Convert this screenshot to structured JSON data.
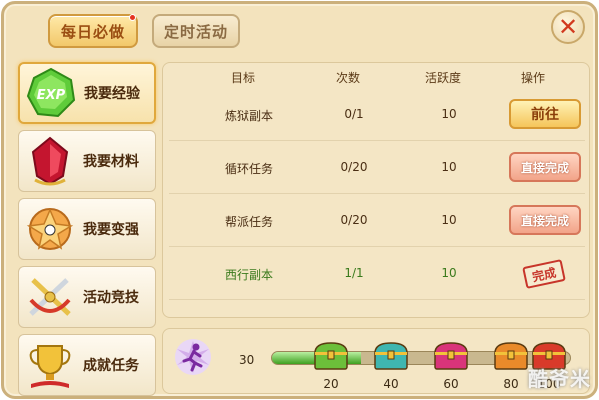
{
  "tabs": [
    {
      "label": "每日必做",
      "active": true,
      "has_notification": true
    },
    {
      "label": "定时活动",
      "active": false
    }
  ],
  "sidebar": {
    "items": [
      {
        "label": "我要经验",
        "icon": "exp-gem-icon",
        "active": true
      },
      {
        "label": "我要材料",
        "icon": "red-crystal-icon",
        "active": false
      },
      {
        "label": "我要变强",
        "icon": "ornament-icon",
        "active": false
      },
      {
        "label": "活动竞技",
        "icon": "crossed-swords-icon",
        "active": false
      },
      {
        "label": "成就任务",
        "icon": "trophy-cup-icon",
        "active": false
      }
    ]
  },
  "table": {
    "headers": [
      "目标",
      "次数",
      "活跃度",
      "操作"
    ],
    "rows": [
      {
        "target": "炼狱副本",
        "count": "0/1",
        "activity": "10",
        "action": "前往",
        "action_type": "go"
      },
      {
        "target": "循环任务",
        "count": "0/20",
        "activity": "10",
        "action": "直接完成",
        "action_type": "complete"
      },
      {
        "target": "帮派任务",
        "count": "0/20",
        "activity": "10",
        "action": "直接完成",
        "action_type": "complete"
      },
      {
        "target": "西行副本",
        "count": "1/1",
        "activity": "10",
        "action": "完成",
        "action_type": "done"
      }
    ]
  },
  "progress": {
    "current": "30",
    "max": 100,
    "milestones": [
      "20",
      "40",
      "60",
      "80",
      "100"
    ],
    "chest_colors": [
      "#6cbf3a",
      "#3fb6b0",
      "#d9347a",
      "#e98a2a",
      "#d93a2a"
    ]
  },
  "watermark": "酷爷米",
  "colors": {
    "accent": "#d09a3f",
    "done_stamp": "#c7352a",
    "progress_fill": "#3ea01f"
  }
}
